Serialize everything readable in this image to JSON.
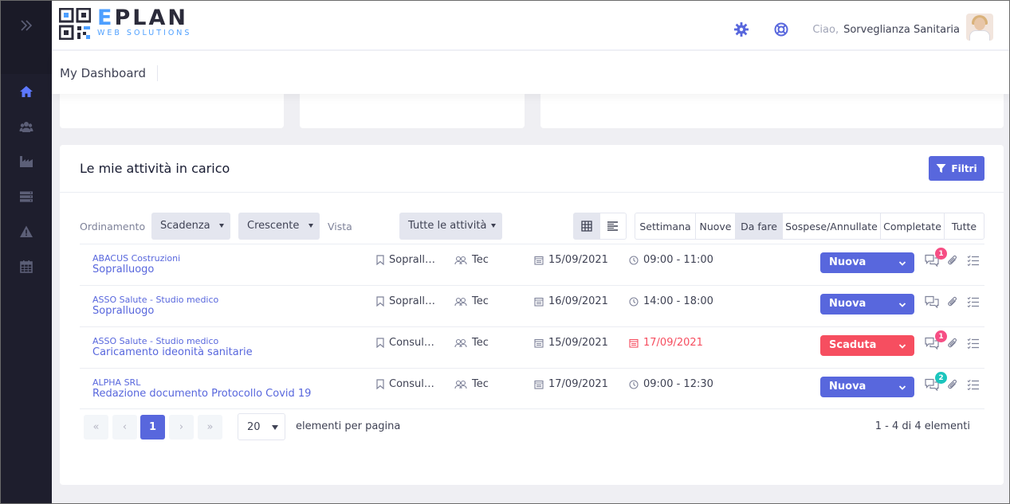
{
  "app": {
    "logo_text": "EPLAN",
    "logo_subtitle": "WEB SOLUTIONS"
  },
  "sidebar": {
    "toggle_icon": "double-chevron-right-icon",
    "items": [
      {
        "icon": "home-icon",
        "active": true
      },
      {
        "icon": "users-icon",
        "active": false
      },
      {
        "icon": "factory-icon",
        "active": false
      },
      {
        "icon": "server-icon",
        "active": false
      },
      {
        "icon": "warning-icon",
        "active": false
      },
      {
        "icon": "calendar-icon",
        "active": false
      }
    ]
  },
  "header": {
    "greeting": "Ciao,",
    "user_name": "Sorveglianza Sanitaria",
    "icons": [
      "settings-icon",
      "support-icon"
    ]
  },
  "subheader": {
    "title": "My Dashboard"
  },
  "panel": {
    "title": "Le mie attività in carico",
    "filter_label": "Filtri",
    "sort_label": "Ordinamento",
    "sort_field": "Scadenza",
    "sort_order": "Crescente",
    "view_label": "Vista",
    "view_value": "Tutte le attività",
    "status_filters": [
      "Settimana",
      "Nuove",
      "Da fare",
      "Sospese/Annullate",
      "Completate",
      "Tutte"
    ],
    "active_status_filter": "Da fare"
  },
  "rows": [
    {
      "client": "ABACUS Costruzioni",
      "title": "Sopralluogo",
      "category": "Sopralluogo",
      "assignee": "Tec",
      "date": "15/09/2021",
      "time": "09:00 - 11:00",
      "overdue": false,
      "status": "Nuova",
      "messages": "1"
    },
    {
      "client": "ASSO Salute - Studio medico",
      "title": "Sopralluogo",
      "category": "Sopralluogo",
      "assignee": "Tec",
      "date": "16/09/2021",
      "time": "14:00 - 18:00",
      "overdue": false,
      "status": "Nuova",
      "messages": ""
    },
    {
      "client": "ASSO Salute - Studio medico",
      "title": "Caricamento ideonità sanitarie",
      "category": "Consulenza",
      "assignee": "Tec",
      "date": "15/09/2021",
      "time": "17/09/2021",
      "overdue": true,
      "status": "Scaduta",
      "messages": "1"
    },
    {
      "client": "ALPHA SRL",
      "title": "Redazione documento Protocollo Covid 19",
      "category": "Consulenza",
      "assignee": "Tec",
      "date": "17/09/2021",
      "time": "09:00 - 12:30",
      "overdue": false,
      "status": "Nuova",
      "messages": "2"
    }
  ],
  "pagination": {
    "current_page": "1",
    "per_page": "20",
    "per_page_label": "elementi per pagina",
    "info": "1 - 4 di 4 elementi"
  },
  "colors": {
    "primary": "#5867dd",
    "danger": "#f64e60",
    "success": "#1bc5bd",
    "badge_pink": "#f64e84",
    "sidebar_bg": "#1e1e2d",
    "sidebar_active": "#5867dd"
  }
}
